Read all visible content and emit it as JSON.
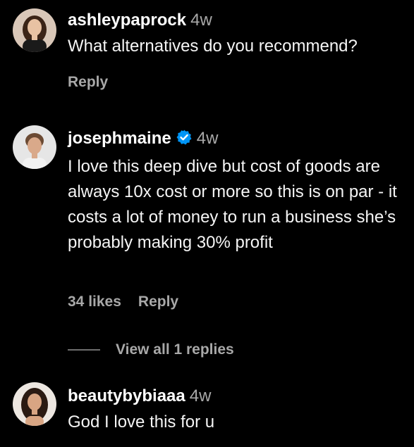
{
  "colors": {
    "background": "#000000",
    "text": "#f5f5f5",
    "secondary": "#a8a8a8",
    "verified_badge": "#0095f6"
  },
  "comments": [
    {
      "username": "ashleypaprock",
      "time": "4w",
      "text": "What alternatives do you recommend?",
      "reply_label": "Reply"
    },
    {
      "username": "josephmaine",
      "verified": true,
      "verified_icon": "verified-badge-icon",
      "time": "4w",
      "text": "I love this deep dive but cost of goods are always 10x cost or more so this is on par - it costs a lot of money to run a business she’s probably making 30% profit",
      "likes_label": "34 likes",
      "reply_label": "Reply",
      "view_replies_label": "View all 1 replies"
    },
    {
      "username": "beautybybiaaa",
      "time": "4w",
      "text": "God I love this for u"
    }
  ]
}
